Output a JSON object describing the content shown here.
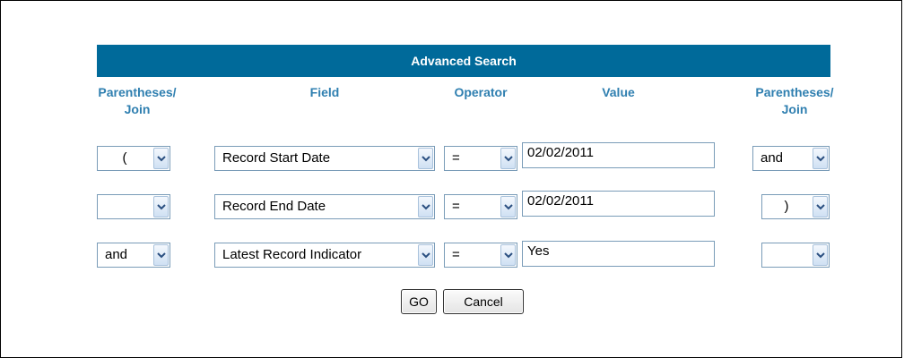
{
  "title": "Advanced Search",
  "columns": {
    "join_left": "Parentheses/ Join",
    "field": "Field",
    "operator": "Operator",
    "value": "Value",
    "join_right": "Parentheses/ Join"
  },
  "rows": [
    {
      "join_left": "(",
      "field": "Record Start Date",
      "operator": "=",
      "value": "02/02/2011",
      "join_right": "and"
    },
    {
      "join_left": "",
      "field": "Record End Date",
      "operator": "=",
      "value": "02/02/2011",
      "join_right": ")"
    },
    {
      "join_left": "and",
      "field": "Latest Record Indicator",
      "operator": "=",
      "value": "Yes",
      "join_right": ""
    }
  ],
  "buttons": {
    "go": "GO",
    "cancel": "Cancel"
  },
  "colors": {
    "header_bg": "#006a9a",
    "column_label": "#2f7fb0"
  },
  "icons": {
    "dropdown": "chevron-down-icon"
  }
}
